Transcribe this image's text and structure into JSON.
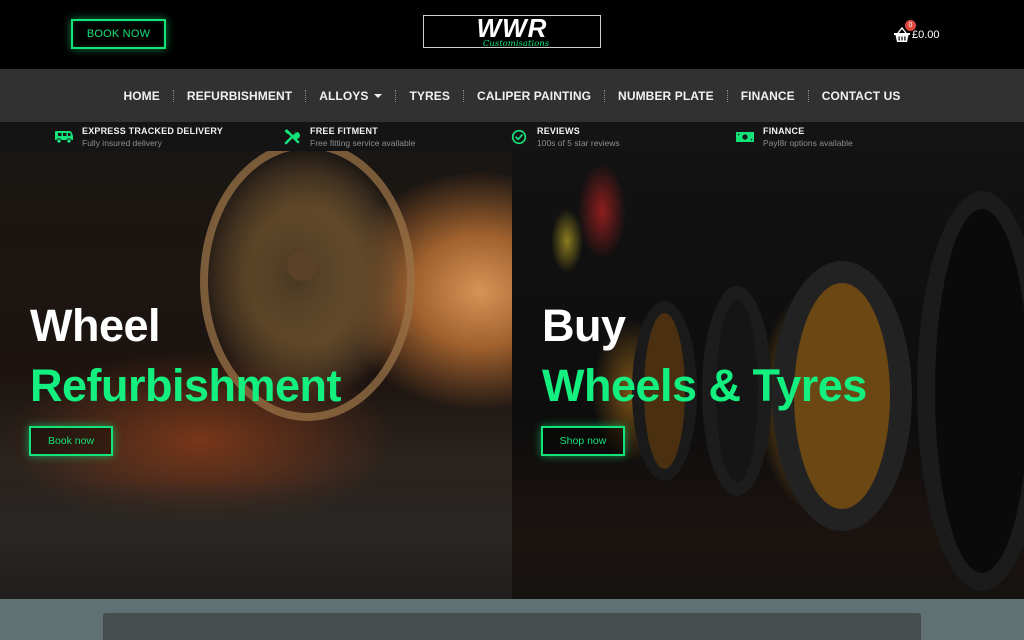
{
  "header": {
    "book_button": "BOOK NOW",
    "logo": {
      "main": "WWR",
      "sub": "Customisations"
    },
    "cart": {
      "icon": "basket-icon",
      "count": "0",
      "total": "£0.00"
    }
  },
  "nav": {
    "items": [
      {
        "label": "HOME",
        "has_dropdown": false
      },
      {
        "label": "REFURBISHMENT",
        "has_dropdown": false
      },
      {
        "label": "ALLOYS",
        "has_dropdown": true
      },
      {
        "label": "TYRES",
        "has_dropdown": false
      },
      {
        "label": "CALIPER PAINTING",
        "has_dropdown": false
      },
      {
        "label": "NUMBER PLATE",
        "has_dropdown": false
      },
      {
        "label": "FINANCE",
        "has_dropdown": false
      },
      {
        "label": "CONTACT US",
        "has_dropdown": false
      }
    ]
  },
  "features": [
    {
      "icon": "van-icon",
      "title": "EXPRESS TRACKED DELIVERY",
      "subtitle": "Fully insured delivery"
    },
    {
      "icon": "tools-icon",
      "title": "FREE FITMENT",
      "subtitle": "Free fitting service available"
    },
    {
      "icon": "check-circle-icon",
      "title": "REVIEWS",
      "subtitle": "100s of 5 star reviews"
    },
    {
      "icon": "money-icon",
      "title": "FINANCE",
      "subtitle": "Payl8r options available"
    }
  ],
  "hero": {
    "left": {
      "title_line1": "Wheel",
      "title_line2": "Refurbishment",
      "button": "Book now"
    },
    "right": {
      "title_line1": "Buy",
      "title_line2": "Wheels & Tyres",
      "button": "Shop now"
    }
  },
  "colors": {
    "accent": "#14F07F",
    "header_bg": "#000000",
    "nav_bg": "#313131",
    "features_bg": "#141414",
    "badge": "#E0473E",
    "bottom_bg": "#5F7172"
  }
}
